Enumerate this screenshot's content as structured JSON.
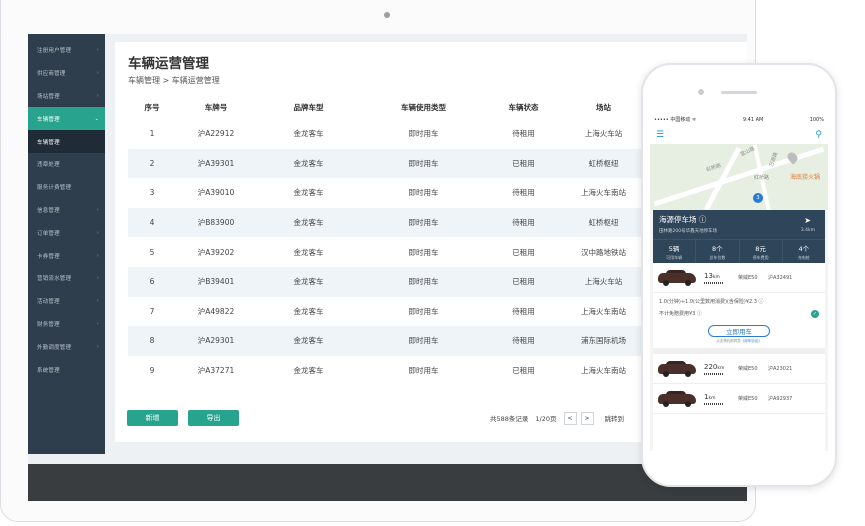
{
  "sidebar": {
    "items": [
      {
        "label": "注册用户管理",
        "chevron": true,
        "state": "normal"
      },
      {
        "label": "供应商管理",
        "chevron": true,
        "state": "normal"
      },
      {
        "label": "场站管理",
        "chevron": true,
        "state": "normal"
      },
      {
        "label": "车辆管理",
        "chevron": true,
        "state": "active"
      },
      {
        "label": "车辆管理",
        "chevron": false,
        "state": "sub"
      },
      {
        "label": "违章处理",
        "chevron": false,
        "state": "normal"
      },
      {
        "label": "服务计费管理",
        "chevron": false,
        "state": "normal"
      },
      {
        "label": "信息管理",
        "chevron": true,
        "state": "normal"
      },
      {
        "label": "订单管理",
        "chevron": true,
        "state": "normal"
      },
      {
        "label": "卡券管理",
        "chevron": true,
        "state": "normal"
      },
      {
        "label": "营销流水管理",
        "chevron": true,
        "state": "normal"
      },
      {
        "label": "活动管理",
        "chevron": true,
        "state": "normal"
      },
      {
        "label": "财务管理",
        "chevron": true,
        "state": "normal"
      },
      {
        "label": "外勤调度管理",
        "chevron": true,
        "state": "normal"
      },
      {
        "label": "系统管理",
        "chevron": false,
        "state": "normal"
      }
    ]
  },
  "main": {
    "title": "车辆运营管理",
    "breadcrumb": "车辆管理 > 车辆运营管理",
    "columns": [
      "序号",
      "车牌号",
      "品牌车型",
      "车辆使用类型",
      "车辆状态",
      "场站"
    ],
    "rows": [
      [
        "1",
        "沪A22912",
        "金龙客车",
        "即时用车",
        "待租用",
        "上海火车站"
      ],
      [
        "2",
        "沪A39301",
        "金龙客车",
        "即时用车",
        "已租用",
        "虹桥枢纽"
      ],
      [
        "3",
        "沪A39010",
        "金龙客车",
        "即时用车",
        "待租用",
        "上海火车南站"
      ],
      [
        "4",
        "沪B83900",
        "金龙客车",
        "即时用车",
        "待租用",
        "虹桥枢纽"
      ],
      [
        "5",
        "沪A39202",
        "金龙客车",
        "即时用车",
        "已租用",
        "汉中路地铁站"
      ],
      [
        "6",
        "沪B39401",
        "金龙客车",
        "即时用车",
        "已租用",
        "上海火车站"
      ],
      [
        "7",
        "沪A49822",
        "金龙客车",
        "即时用车",
        "待租用",
        "上海火车南站"
      ],
      [
        "8",
        "沪A29301",
        "金龙客车",
        "即时用车",
        "待租用",
        "浦东国际机场"
      ],
      [
        "9",
        "沪A37271",
        "金龙客车",
        "即时用车",
        "已租用",
        "上海火车南站"
      ]
    ],
    "add_label": "新增",
    "export_label": "导出",
    "pager": {
      "total": "共588条记录",
      "page": "1/20页",
      "prev": "<",
      "next": ">",
      "jump": "跳转到"
    }
  },
  "phone": {
    "status": {
      "carrier": "••••• 中国移动 ᯤ",
      "time": "9:41 AM",
      "battery": "100%"
    },
    "menu_icon": "☰",
    "search_icon": "⚲",
    "map": {
      "labels": [
        "虹桥路",
        "万源路",
        "宜山路",
        "红桥路"
      ],
      "poi": "海底捞火锅",
      "marker": "3"
    },
    "lot": {
      "name": "海源停车场",
      "address": "田林路200号华鑫天地停车场",
      "distance": "3.4km"
    },
    "stats": [
      {
        "value": "5辆",
        "label": "可用车辆"
      },
      {
        "value": "8个",
        "label": "总车位数"
      },
      {
        "value": "8元",
        "label": "停车费用"
      },
      {
        "value": "4个",
        "label": "充电桩"
      }
    ],
    "cars": [
      {
        "range": "13",
        "unit": "km",
        "model": "荣威E50",
        "plate": "沪A32491"
      },
      {
        "range": "220",
        "unit": "km",
        "model": "荣威E50",
        "plate": "沪A23021"
      },
      {
        "range": "1",
        "unit": "km",
        "model": "荣威E50",
        "plate": "沪A92937"
      }
    ],
    "price": "1.0(分钟)+1.0(公里数用消费)(含保险)¥2.3",
    "insurance": "不计免赔费用¥3",
    "rent_label": "立即用车",
    "agree_text": "点击预约即同意",
    "agree_link": "《用车协议》"
  },
  "colors": {
    "accent": "#27a38e",
    "sidebar": "#2f3e4c",
    "phone_card": "#2f4559",
    "link": "#2a7bd6"
  }
}
